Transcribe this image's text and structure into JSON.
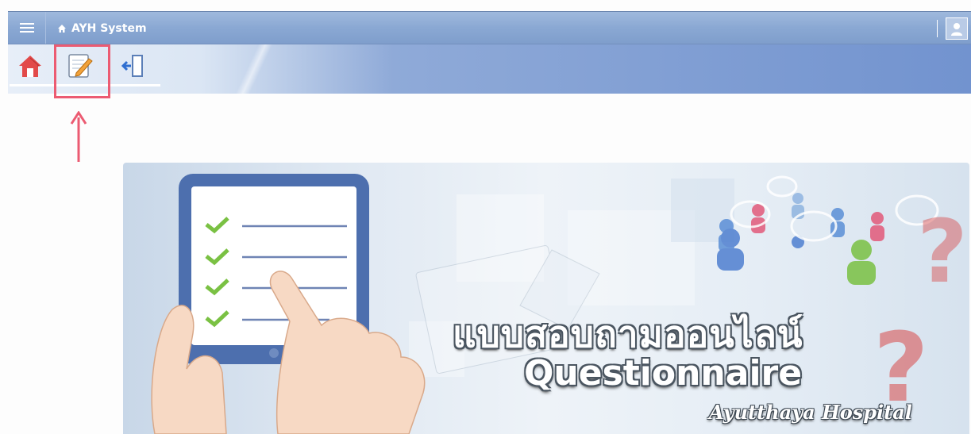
{
  "app": {
    "title": "AYH System"
  },
  "toolbar": {
    "items": [
      {
        "name": "home",
        "icon": "home-icon"
      },
      {
        "name": "questionnaire",
        "icon": "edit-note-icon",
        "highlighted": true
      },
      {
        "name": "logout",
        "icon": "logout-icon"
      }
    ]
  },
  "banner": {
    "title_th": "แบบสอบถามออนไลน์",
    "title_en": "Questionnaire",
    "subtitle": "Ayutthaya Hospital"
  },
  "colors": {
    "titlebar": "#8aa8d3",
    "toolbar_accent": "#7293cf",
    "highlight": "#ec5b72",
    "check": "#7ac143",
    "tablet_frame": "#4d6fae"
  }
}
